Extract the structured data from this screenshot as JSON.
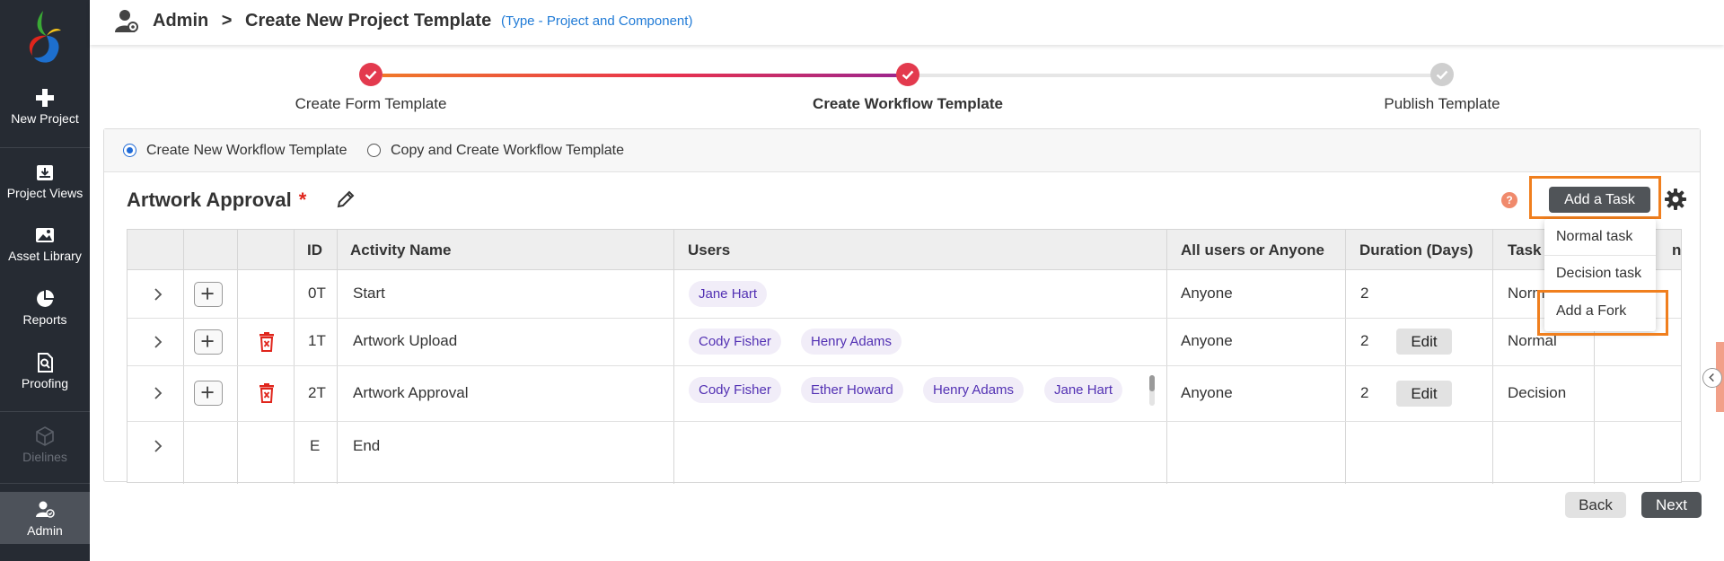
{
  "colors": {
    "sidebar": "#262b33",
    "accent_orange": "#f07f1e",
    "step_done": "#e33a4e",
    "chip_text": "#5230b3",
    "link_blue": "#1f7ad6"
  },
  "sidebar": {
    "items": [
      {
        "label": "New Project",
        "icon": "plus-icon",
        "state": "normal"
      },
      {
        "label": "Project Views",
        "icon": "archive-icon",
        "state": "normal"
      },
      {
        "label": "Asset Library",
        "icon": "image-icon",
        "state": "normal"
      },
      {
        "label": "Reports",
        "icon": "pie-chart-icon",
        "state": "normal"
      },
      {
        "label": "Proofing",
        "icon": "search-document-icon",
        "state": "normal"
      },
      {
        "label": "Dielines",
        "icon": "box-icon",
        "state": "disabled"
      },
      {
        "label": "Admin",
        "icon": "admin-user-icon",
        "state": "active"
      }
    ]
  },
  "header": {
    "section": "Admin",
    "separator": ">",
    "page": "Create New Project Template",
    "type_note": "(Type - Project and Component)"
  },
  "stepper": {
    "steps": [
      {
        "label": "Create Form Template",
        "state": "done"
      },
      {
        "label": "Create Workflow Template",
        "state": "done"
      },
      {
        "label": "Publish Template",
        "state": "pending"
      }
    ]
  },
  "options": {
    "create_new": "Create New Workflow Template",
    "copy_create": "Copy and Create Workflow Template",
    "selected": "create_new"
  },
  "workflow": {
    "title": "Artwork Approval",
    "required_mark": "*",
    "help_label": "?",
    "add_task_label": "Add a Task"
  },
  "dropdown": {
    "items": [
      "Normal task",
      "Decision task",
      "Add a Fork"
    ]
  },
  "table": {
    "headers": {
      "id": "ID",
      "activity": "Activity Name",
      "users": "Users",
      "all_or_anyone": "All users or Anyone",
      "duration": "Duration (Days)",
      "task": "Task",
      "action": "n"
    },
    "rows": [
      {
        "id": "0T",
        "activity": "Start",
        "users": [
          "Jane Hart"
        ],
        "all_or_anyone": "Anyone",
        "duration": "2",
        "task": "Norm",
        "edit": ""
      },
      {
        "id": "1T",
        "activity": "Artwork Upload",
        "users": [
          "Cody Fisher",
          "Henry Adams"
        ],
        "all_or_anyone": "Anyone",
        "duration": "2",
        "task": "Normal",
        "edit": "Edit"
      },
      {
        "id": "2T",
        "activity": "Artwork Approval",
        "users": [
          "Cody Fisher",
          "Ether Howard",
          "Henry Adams",
          "Jane Hart"
        ],
        "all_or_anyone": "Anyone",
        "duration": "2",
        "task": "Decision",
        "edit": "Edit"
      },
      {
        "id": "E",
        "activity": "End",
        "users": [],
        "all_or_anyone": "",
        "duration": "",
        "task": "",
        "edit": ""
      }
    ]
  },
  "footer": {
    "back_label": "Back",
    "next_label": "Next"
  }
}
